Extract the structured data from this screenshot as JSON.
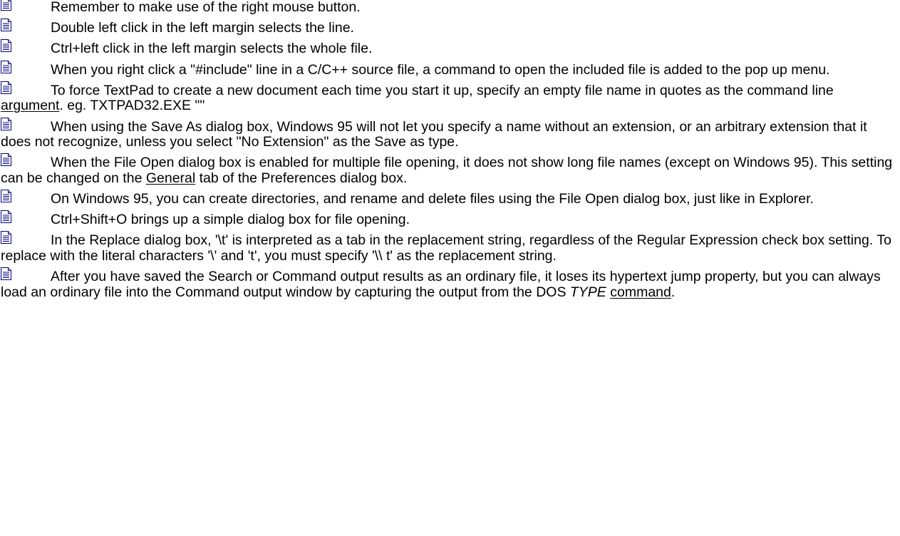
{
  "tips": [
    {
      "parts": [
        {
          "t": "Remember to make use of the right mouse button."
        }
      ]
    },
    {
      "parts": [
        {
          "t": "Double left click in the left margin selects the line."
        }
      ]
    },
    {
      "parts": [
        {
          "t": "Ctrl+left click in the left margin selects the whole file."
        }
      ]
    },
    {
      "parts": [
        {
          "t": "When you right click a \"#include\" line in a C/C++ source file, a command to open the included file is added to the pop up menu."
        }
      ]
    },
    {
      "parts": [
        {
          "t": "To force TextPad to create a new document each time you start it up, specify an empty file name in quotes as the command line "
        },
        {
          "t": "argument",
          "link": true
        },
        {
          "t": ". eg.   TXTPAD32.EXE \"\""
        }
      ]
    },
    {
      "parts": [
        {
          "t": "When using the Save As dialog box, Windows 95 will not let you specify a name without an extension, or an arbitrary extension that it does not recognize, unless you select \"No Extension\" as the Save as type."
        }
      ]
    },
    {
      "parts": [
        {
          "t": "When the File Open dialog box is enabled for multiple file opening, it does not show long file names (except on Windows 95).   This setting can be changed on the "
        },
        {
          "t": "General",
          "link": true
        },
        {
          "t": " tab of the Preferences dialog box."
        }
      ]
    },
    {
      "parts": [
        {
          "t": "On Windows 95, you can create directories, and rename and delete files using the File Open dialog box, just like in Explorer."
        }
      ]
    },
    {
      "parts": [
        {
          "t": "Ctrl+Shift+O brings up a simple dialog box for file opening."
        }
      ]
    },
    {
      "parts": [
        {
          "t": "In the Replace dialog box, '\\t' is interpreted as a tab in the replacement string, regardless of the Regular Expression check box setting.   To replace with the literal characters '\\' and 't', you must specify '\\\\ t' as the replacement string."
        }
      ]
    },
    {
      "parts": [
        {
          "t": "After you have saved the Search or Command output results as an ordinary file, it loses its hypertext jump property, but you can always load an ordinary file into the Command output window by capturing the output from the DOS "
        },
        {
          "t": "TYPE",
          "italic": true
        },
        {
          "t": " "
        },
        {
          "t": "command",
          "link": true
        },
        {
          "t": "."
        }
      ]
    }
  ],
  "icon": "document-icon",
  "colors": {
    "text": "#000000",
    "background": "#ffffff",
    "icon_fill": "#ffffff",
    "icon_outline": "#000080",
    "icon_lines": "#000080"
  }
}
